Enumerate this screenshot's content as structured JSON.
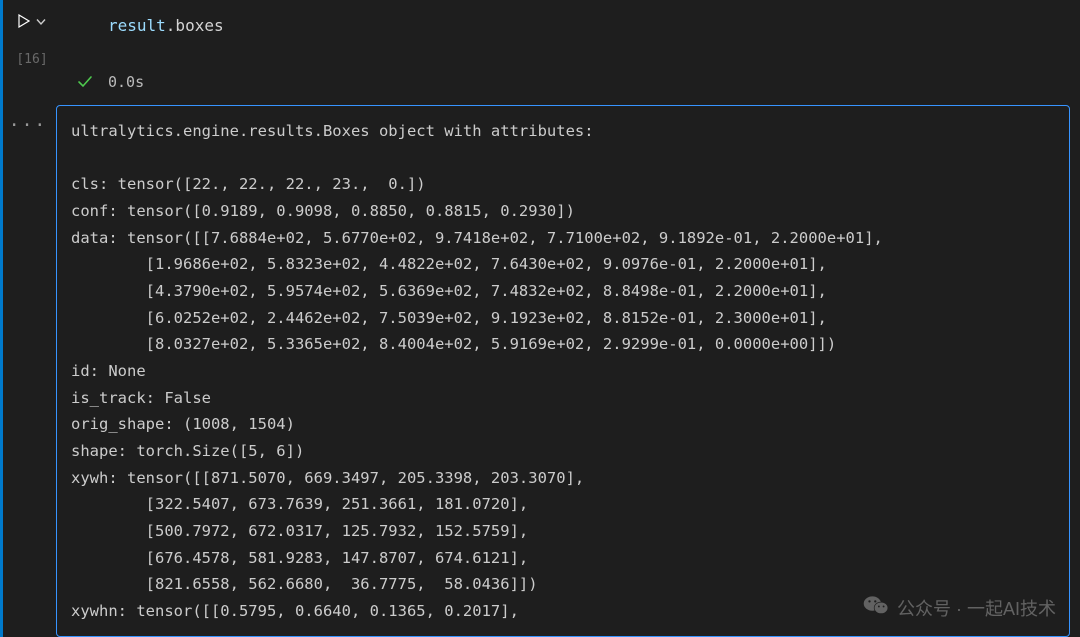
{
  "cell": {
    "exec_count_label": "[16]",
    "code_object": "result",
    "code_property": ".boxes",
    "exec_time": "0.0s",
    "more_gutter": "···"
  },
  "output": {
    "lines": [
      "ultralytics.engine.results.Boxes object with attributes:",
      "",
      "cls: tensor([22., 22., 22., 23.,  0.])",
      "conf: tensor([0.9189, 0.9098, 0.8850, 0.8815, 0.2930])",
      "data: tensor([[7.6884e+02, 5.6770e+02, 9.7418e+02, 7.7100e+02, 9.1892e-01, 2.2000e+01],",
      "        [1.9686e+02, 5.8323e+02, 4.4822e+02, 7.6430e+02, 9.0976e-01, 2.2000e+01],",
      "        [4.3790e+02, 5.9574e+02, 5.6369e+02, 7.4832e+02, 8.8498e-01, 2.2000e+01],",
      "        [6.0252e+02, 2.4462e+02, 7.5039e+02, 9.1923e+02, 8.8152e-01, 2.3000e+01],",
      "        [8.0327e+02, 5.3365e+02, 8.4004e+02, 5.9169e+02, 2.9299e-01, 0.0000e+00]])",
      "id: None",
      "is_track: False",
      "orig_shape: (1008, 1504)",
      "shape: torch.Size([5, 6])",
      "xywh: tensor([[871.5070, 669.3497, 205.3398, 203.3070],",
      "        [322.5407, 673.7639, 251.3661, 181.0720],",
      "        [500.7972, 672.0317, 125.7932, 152.5759],",
      "        [676.4578, 581.9283, 147.8707, 674.6121],",
      "        [821.6558, 562.6680,  36.7775,  58.0436]])",
      "xywhn: tensor([[0.5795, 0.6640, 0.1365, 0.2017],"
    ]
  },
  "watermark": {
    "label": "公众号 · 一起AI技术"
  }
}
